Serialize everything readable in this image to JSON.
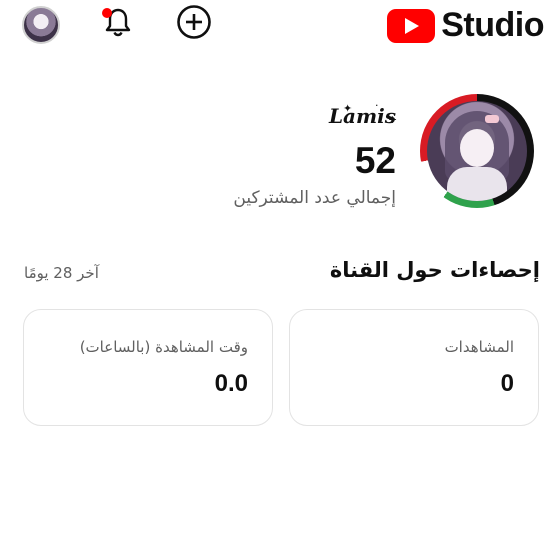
{
  "header": {
    "logo_text": "Studio",
    "accent_color": "#ff0000",
    "icons": [
      "account-avatar",
      "notifications-bell-icon",
      "create-plus-icon",
      "youtube-play-icon"
    ]
  },
  "channel": {
    "name": "Lamis",
    "subscriber_count": "52",
    "subscriber_label": "إجمالي عدد المشتركين"
  },
  "analytics": {
    "title": "إحصاءات حول القناة",
    "period": "آخر 28 يومًا",
    "cards": [
      {
        "label": "المشاهدات",
        "value": "0"
      },
      {
        "label": "وقت المشاهدة (بالساعات)",
        "value": "0.0"
      }
    ]
  }
}
